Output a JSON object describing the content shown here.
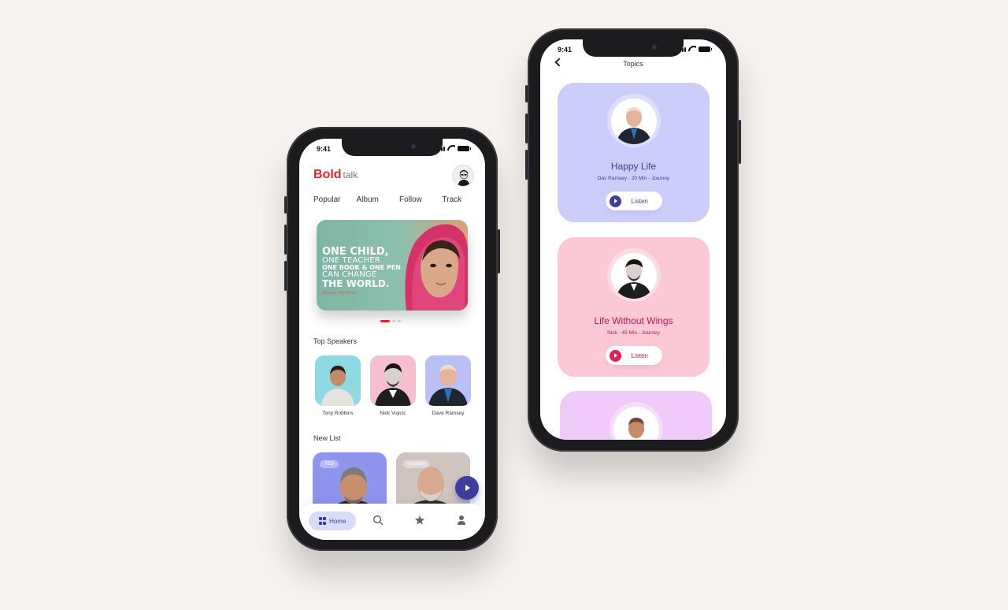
{
  "left_phone": {
    "status_time": "9:41",
    "brand": {
      "bold": "Bold",
      "rest": "talk"
    },
    "tabs": [
      "Popular",
      "Album",
      "Follow",
      "Track"
    ],
    "banner": {
      "line1": "ONE CHILD,",
      "line2": "ONE TEACHER",
      "line3": "ONE BOOK & ONE PEN",
      "line4": "CAN CHANGE",
      "line5": "THE WORLD.",
      "credit": "MALALA YOUSAFZAI"
    },
    "carousel_active_index": 1,
    "top_speakers_title": "Top Speakers",
    "speakers": [
      {
        "name": "Tony Robbins",
        "bg": "#8fd9e3"
      },
      {
        "name": "Nick Vujicic",
        "bg": "#f6bfd0"
      },
      {
        "name": "Dave Ramsey",
        "bg": "#b9c0f5"
      }
    ],
    "new_list_title": "New List",
    "new_list": [
      {
        "tag": "TED",
        "bg": "#8f95ef"
      },
      {
        "tag": "Youtube",
        "bg": "#cfc4c0"
      }
    ],
    "nav": {
      "home_label": "Home"
    }
  },
  "right_phone": {
    "status_time": "9:41",
    "title": "Topics",
    "cards": [
      {
        "title": "Happy Life",
        "subtitle": "Dav Ramsey - 20 Min - Journey",
        "listen": "Listen",
        "bg": "#cccdfb",
        "accent": "#3d3f9f",
        "text_color": "#3d3f9f"
      },
      {
        "title": "Life Without Wings",
        "subtitle": "Nick - 45 Min - Journey",
        "listen": "Listen",
        "bg": "#fbc8d6",
        "accent": "#e81e5a",
        "text_color": "#c0184a"
      },
      {
        "bg": "#efc9f7"
      }
    ]
  }
}
